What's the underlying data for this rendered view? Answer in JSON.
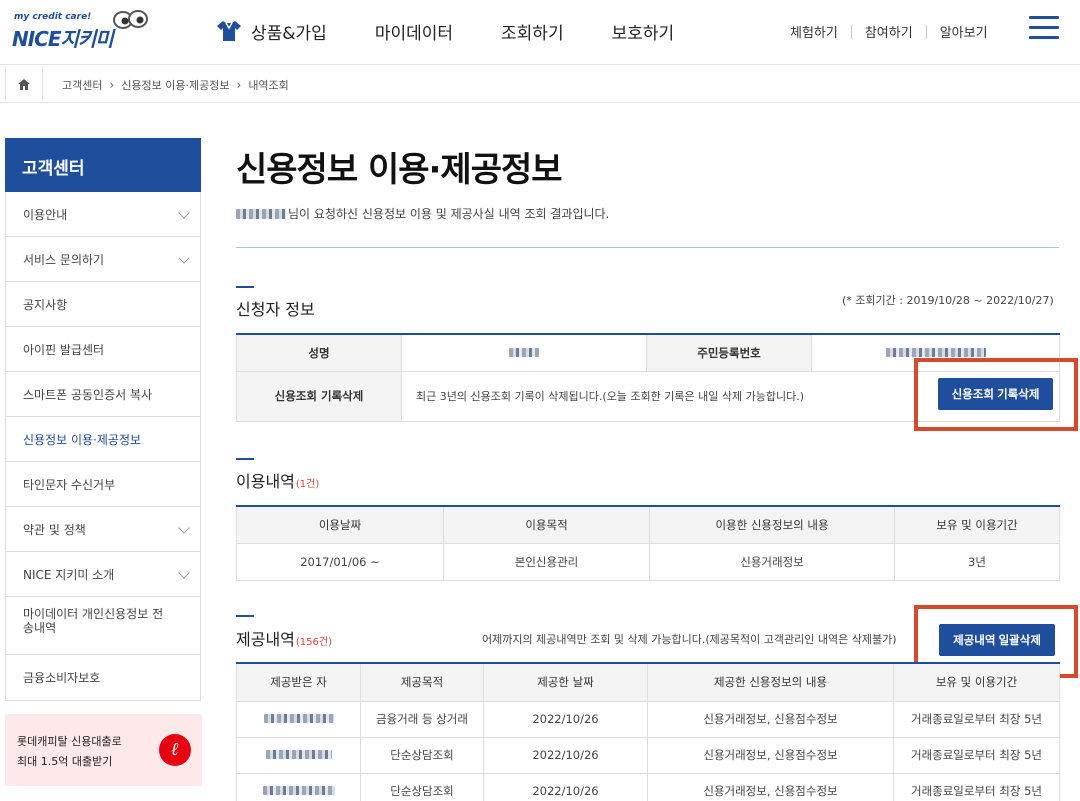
{
  "header": {
    "logo_tagline": "my credit care!",
    "logo_brand": "NICE지키미",
    "gnb": [
      "상품&가입",
      "마이데이터",
      "조회하기",
      "보호하기"
    ],
    "util": [
      "체험하기",
      "참여하기",
      "알아보기"
    ]
  },
  "breadcrumb": [
    "고객센터",
    "신용정보 이용·제공정보",
    "내역조회"
  ],
  "sidebar": {
    "title": "고객센터",
    "items": [
      {
        "label": "이용안내",
        "arrow": true
      },
      {
        "label": "서비스 문의하기",
        "arrow": true
      },
      {
        "label": "공지사항",
        "arrow": false
      },
      {
        "label": "아이핀 발급센터",
        "arrow": false
      },
      {
        "label": "스마트폰 공동인증서 복사",
        "arrow": false
      },
      {
        "label": "신용정보 이용·제공정보",
        "arrow": false,
        "active": true
      },
      {
        "label": "타인문자 수신거부",
        "arrow": false
      },
      {
        "label": "약관 및 정책",
        "arrow": true
      },
      {
        "label": "NICE 지키미 소개",
        "arrow": true
      },
      {
        "label": "마이데이터 개인신용정보 전송내역",
        "arrow": false,
        "tall": true
      },
      {
        "label": "금융소비자보호",
        "arrow": false
      }
    ],
    "promo_line1": "롯데캐피탈 신용대출로",
    "promo_line2": "최대 1.5억 대출받기"
  },
  "main": {
    "title": "신용정보 이용·제공정보",
    "intro": "님이 요청하신 신용정보 이용 및 제공사실 내역 조회 결과입니다.",
    "applicant": {
      "title": "신청자 정보",
      "period": "(* 조회기간 : 2019/10/28 ~ 2022/10/27)",
      "name_label": "성명",
      "rrn_label": "주민등록번호",
      "delete_label": "신용조회 기록삭제",
      "delete_desc": "최근 3년의 신용조회 기록이 삭제됩니다.(오늘 조회한 기록은 내일 삭제 가능합니다.)",
      "delete_button": "신용조회 기록삭제"
    },
    "usage": {
      "title": "이용내역",
      "count": "(1건)",
      "headers": [
        "이용날짜",
        "이용목적",
        "이용한 신용정보의 내용",
        "보유 및 이용기간"
      ],
      "rows": [
        [
          "2017/01/06 ~",
          "본인신용관리",
          "신용거래정보",
          "3년"
        ]
      ]
    },
    "provision": {
      "title": "제공내역",
      "count": "(156건)",
      "note": "어제까지의 제공내역만 조회 및 삭제 가능합니다.(제공목적이 고객관리인 내역은 삭제불가)",
      "button": "제공내역 일괄삭제",
      "headers": [
        "제공받은 자",
        "제공목적",
        "제공한 날짜",
        "제공한 신용정보의 내용",
        "보유 및 이용기간"
      ],
      "rows": [
        [
          "",
          "금융거래 등 상거래",
          "2022/10/26",
          "신용거래정보, 신용점수정보",
          "거래종료일로부터 최장 5년"
        ],
        [
          "",
          "단순상담조회",
          "2022/10/26",
          "신용거래정보, 신용점수정보",
          "거래종료일로부터 최장 5년"
        ],
        [
          "",
          "단순상담조회",
          "2022/10/26",
          "신용거래정보, 신용점수정보",
          "거래종료일로부터 최장 5년"
        ]
      ]
    }
  },
  "colors": {
    "brand": "#1e4e9c",
    "highlight": "#d6492a",
    "count": "#e0402a"
  }
}
